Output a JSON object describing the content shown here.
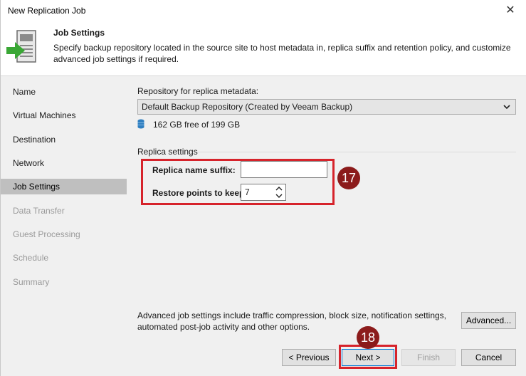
{
  "window": {
    "title": "New Replication Job"
  },
  "header": {
    "title": "Job Settings",
    "description": "Specify backup repository located in the source site to host metadata in, replica suffix and retention policy, and customize advanced job settings if required."
  },
  "sidebar": {
    "items": [
      {
        "label": "Name",
        "state": "enabled"
      },
      {
        "label": "Virtual Machines",
        "state": "enabled"
      },
      {
        "label": "Destination",
        "state": "enabled"
      },
      {
        "label": "Network",
        "state": "enabled"
      },
      {
        "label": "Job Settings",
        "state": "active"
      },
      {
        "label": "Data Transfer",
        "state": "disabled"
      },
      {
        "label": "Guest Processing",
        "state": "disabled"
      },
      {
        "label": "Schedule",
        "state": "disabled"
      },
      {
        "label": "Summary",
        "state": "disabled"
      }
    ]
  },
  "repository": {
    "label": "Repository for replica metadata:",
    "selected": "Default Backup Repository (Created by Veeam Backup)",
    "free_space": "162 GB free of 199 GB"
  },
  "replica_settings": {
    "group_label": "Replica settings",
    "suffix_label": "Replica name suffix:",
    "suffix_value": "",
    "restore_points_label": "Restore points to keep:",
    "restore_points_value": "7"
  },
  "advanced": {
    "description": "Advanced job settings include traffic compression, block size, notification settings, automated post-job activity and other options.",
    "button_label": "Advanced..."
  },
  "footer": {
    "previous_label": "< Previous",
    "next_label": "Next >",
    "finish_label": "Finish",
    "cancel_label": "Cancel"
  },
  "callouts": {
    "step_17": "17",
    "step_18": "18"
  },
  "colors": {
    "highlight": "#d6232b",
    "callout_bg": "#8b1b1b",
    "panel_bg": "#f0f0f0",
    "active_nav": "#bfbfbf",
    "icon_green": "#3aa735",
    "db_icon_blue": "#2f7fc1"
  }
}
